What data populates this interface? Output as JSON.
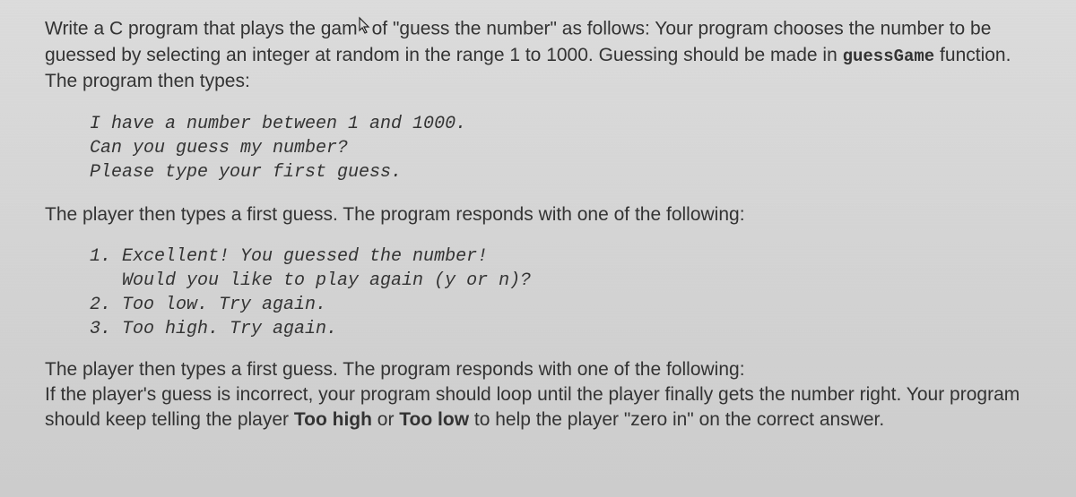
{
  "para1_prefix": "Write a C program that plays the gam",
  "para1_after_cursor": "of \"guess the number\" as follows:  Your program chooses the number to be guessed by selecting an integer at random in the range 1 to 1000. Guessing should be made in ",
  "inline_code": "guessGame",
  "para1_suffix": " function. The program then types:",
  "code_block_1": "I have a number between 1 and 1000.\nCan you guess my number?\nPlease type your first guess.",
  "para2": "The player then types a first guess. The program responds with one of the following:",
  "code_block_2": "1. Excellent! You guessed the number!\n   Would you like to play again (y or n)?\n2. Too low. Try again.\n3. Too high. Try again.",
  "para3_line1": "The player then types a first guess. The program responds with one of the following:",
  "para3_line2_pre": "If the player's guess is incorrect, your program should loop until the player finally gets the number right. Your program should keep telling the player ",
  "bold1": "Too high",
  "mid": " or ",
  "bold2": "Too low",
  "para3_line2_post": " to help the player \"zero in\" on the correct answer."
}
